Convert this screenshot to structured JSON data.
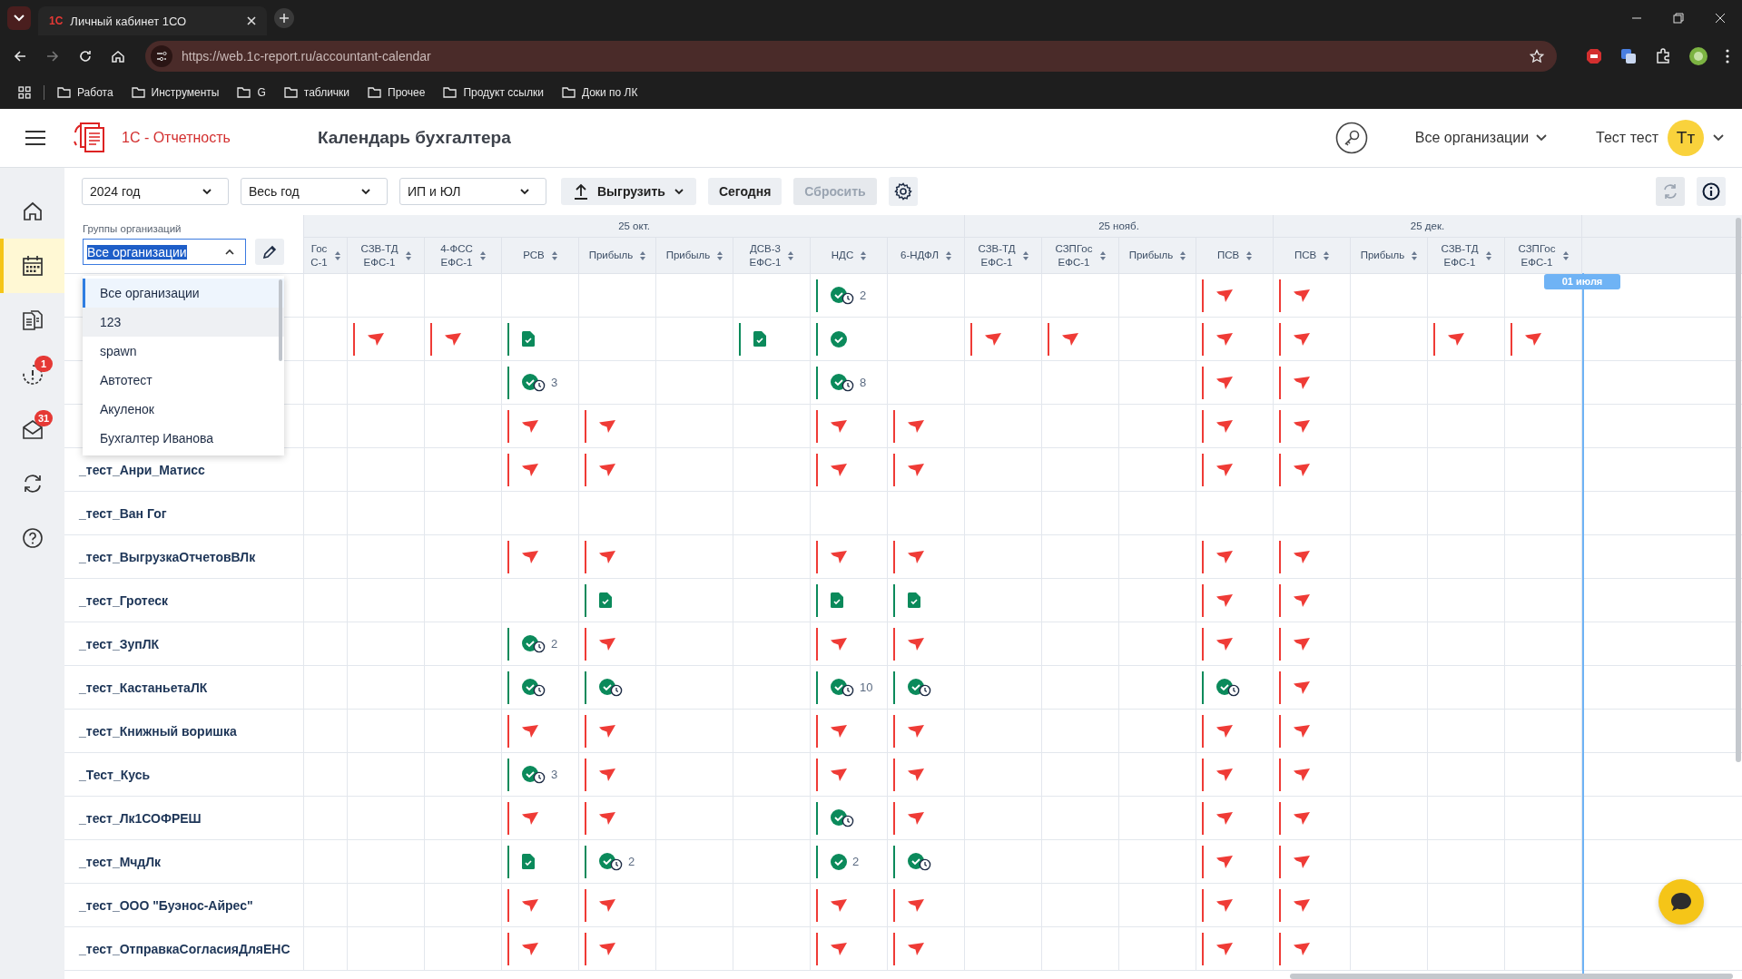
{
  "browser": {
    "tab": {
      "favicon": "1С",
      "title": "Личный кабинет 1СО"
    },
    "url": "https://web.1c-report.ru/accountant-calendar",
    "bookmarks": [
      "Работа",
      "Инструменты",
      "G",
      "таблички",
      "Прочее",
      "Продукт ссылки",
      "Доки по ЛК"
    ]
  },
  "header": {
    "brand": "1С - Отчетность",
    "title": "Календарь бухгалтера",
    "org_menu": "Все организации",
    "user": "Тест тест",
    "avatar": "Тт"
  },
  "sidebar": [
    {
      "kind": "home",
      "selected": false
    },
    {
      "kind": "calendar",
      "selected": true
    },
    {
      "kind": "documents",
      "selected": false
    },
    {
      "kind": "alerts",
      "selected": false,
      "badge": "1"
    },
    {
      "kind": "mail",
      "selected": false,
      "badge": "31"
    },
    {
      "kind": "sync",
      "selected": false
    },
    {
      "kind": "help",
      "selected": false
    }
  ],
  "toolbar": {
    "selects": [
      "2024 год",
      "Весь год",
      "ИП и ЮЛ"
    ],
    "export": "Выгрузить",
    "today": "Сегодня",
    "reset": {
      "label": "Сбросить",
      "disabled": true
    },
    "refresh_disabled": true
  },
  "filter": {
    "label": "Группы организаций",
    "value": "Все организации",
    "expanded": true,
    "options": [
      {
        "label": "Все организации",
        "selected": true,
        "hovered": false
      },
      {
        "label": "123",
        "selected": false,
        "hovered": true
      },
      {
        "label": "spawn",
        "selected": false,
        "hovered": false
      },
      {
        "label": "Автотест",
        "selected": false,
        "hovered": false
      },
      {
        "label": "Акуленок",
        "selected": false,
        "hovered": false
      },
      {
        "label": "Бухгалтер Иванова",
        "selected": false,
        "hovered": false
      }
    ]
  },
  "calendar": {
    "today_marker": "01 июля",
    "groups": [
      {
        "date": "25 окт.",
        "columns": [
          {
            "lines": [
              "Гос",
              "С-1"
            ],
            "partial": true
          },
          {
            "lines": [
              "СЗВ-ТД",
              "ЕФС-1"
            ]
          },
          {
            "lines": [
              "4-ФСС",
              "ЕФС-1"
            ]
          },
          {
            "lines": [
              "РСВ"
            ]
          },
          {
            "lines": [
              "Прибыль"
            ]
          },
          {
            "lines": [
              "Прибыль"
            ]
          },
          {
            "lines": [
              "ДСВ-3",
              "ЕФС-1"
            ]
          },
          {
            "lines": [
              "НДС"
            ]
          },
          {
            "lines": [
              "6-НДФЛ"
            ]
          }
        ]
      },
      {
        "date": "25 нояб.",
        "columns": [
          {
            "lines": [
              "СЗВ-ТД",
              "ЕФС-1"
            ]
          },
          {
            "lines": [
              "СЗПГос",
              "ЕФС-1"
            ]
          },
          {
            "lines": [
              "Прибыль"
            ]
          },
          {
            "lines": [
              "ПСВ"
            ]
          }
        ]
      },
      {
        "date": "25 дек.",
        "columns": [
          {
            "lines": [
              "ПСВ"
            ]
          },
          {
            "lines": [
              "Прибыль"
            ]
          },
          {
            "lines": [
              "СЗВ-ТД",
              "ЕФС-1"
            ]
          },
          {
            "lines": [
              "СЗПГос",
              "ЕФС-1"
            ]
          }
        ]
      }
    ],
    "rows": [
      {
        "cells": [
          {
            "kind": "none"
          },
          {
            "kind": "none"
          },
          {
            "kind": "none"
          },
          {
            "kind": "none"
          },
          {
            "kind": "none"
          },
          {
            "kind": "none"
          },
          {
            "kind": "none"
          },
          {
            "kind": "pending",
            "count": "2"
          },
          {
            "kind": "none"
          },
          {
            "kind": "none"
          },
          {
            "kind": "none"
          },
          {
            "kind": "none"
          },
          {
            "kind": "sent"
          },
          {
            "kind": "sent"
          },
          {
            "kind": "none"
          },
          {
            "kind": "none"
          },
          {
            "kind": "none"
          }
        ]
      },
      {
        "cells": [
          {
            "kind": "none"
          },
          {
            "kind": "sent"
          },
          {
            "kind": "sent"
          },
          {
            "kind": "doc"
          },
          {
            "kind": "none"
          },
          {
            "kind": "none"
          },
          {
            "kind": "doc"
          },
          {
            "kind": "accepted"
          },
          {
            "kind": "none"
          },
          {
            "kind": "sent"
          },
          {
            "kind": "sent"
          },
          {
            "kind": "none"
          },
          {
            "kind": "sent"
          },
          {
            "kind": "sent"
          },
          {
            "kind": "none"
          },
          {
            "kind": "sent"
          },
          {
            "kind": "sent"
          }
        ]
      },
      {
        "cells": [
          {
            "kind": "none"
          },
          {
            "kind": "none"
          },
          {
            "kind": "none"
          },
          {
            "kind": "pending",
            "count": "3"
          },
          {
            "kind": "none"
          },
          {
            "kind": "none"
          },
          {
            "kind": "none"
          },
          {
            "kind": "pending",
            "count": "8"
          },
          {
            "kind": "none"
          },
          {
            "kind": "none"
          },
          {
            "kind": "none"
          },
          {
            "kind": "none"
          },
          {
            "kind": "sent"
          },
          {
            "kind": "sent"
          },
          {
            "kind": "none"
          },
          {
            "kind": "none"
          },
          {
            "kind": "none"
          }
        ]
      },
      {
        "cells": [
          {
            "kind": "none"
          },
          {
            "kind": "none"
          },
          {
            "kind": "none"
          },
          {
            "kind": "sent"
          },
          {
            "kind": "sent"
          },
          {
            "kind": "none"
          },
          {
            "kind": "none"
          },
          {
            "kind": "sent"
          },
          {
            "kind": "sent"
          },
          {
            "kind": "none"
          },
          {
            "kind": "none"
          },
          {
            "kind": "none"
          },
          {
            "kind": "sent"
          },
          {
            "kind": "sent"
          },
          {
            "kind": "none"
          },
          {
            "kind": "none"
          },
          {
            "kind": "none"
          }
        ]
      },
      {
        "name": "_тест_Анри_Матисс",
        "cells": [
          {
            "kind": "none"
          },
          {
            "kind": "none"
          },
          {
            "kind": "none"
          },
          {
            "kind": "sent"
          },
          {
            "kind": "sent"
          },
          {
            "kind": "none"
          },
          {
            "kind": "none"
          },
          {
            "kind": "sent"
          },
          {
            "kind": "sent"
          },
          {
            "kind": "none"
          },
          {
            "kind": "none"
          },
          {
            "kind": "none"
          },
          {
            "kind": "sent"
          },
          {
            "kind": "sent"
          },
          {
            "kind": "none"
          },
          {
            "kind": "none"
          },
          {
            "kind": "none"
          }
        ]
      },
      {
        "name": "_тест_Ван Гог",
        "cells": [
          {
            "kind": "none"
          },
          {
            "kind": "none"
          },
          {
            "kind": "none"
          },
          {
            "kind": "none"
          },
          {
            "kind": "none"
          },
          {
            "kind": "none"
          },
          {
            "kind": "none"
          },
          {
            "kind": "none"
          },
          {
            "kind": "none"
          },
          {
            "kind": "none"
          },
          {
            "kind": "none"
          },
          {
            "kind": "none"
          },
          {
            "kind": "none"
          },
          {
            "kind": "none"
          },
          {
            "kind": "none"
          },
          {
            "kind": "none"
          },
          {
            "kind": "none"
          }
        ]
      },
      {
        "name": "_тест_ВыгрузкаОтчетовВЛк",
        "cells": [
          {
            "kind": "none"
          },
          {
            "kind": "none"
          },
          {
            "kind": "none"
          },
          {
            "kind": "sent"
          },
          {
            "kind": "sent"
          },
          {
            "kind": "none"
          },
          {
            "kind": "none"
          },
          {
            "kind": "sent"
          },
          {
            "kind": "sent"
          },
          {
            "kind": "none"
          },
          {
            "kind": "none"
          },
          {
            "kind": "none"
          },
          {
            "kind": "sent"
          },
          {
            "kind": "sent"
          },
          {
            "kind": "none"
          },
          {
            "kind": "none"
          },
          {
            "kind": "none"
          }
        ]
      },
      {
        "name": "_тест_Гротеск",
        "cells": [
          {
            "kind": "none"
          },
          {
            "kind": "none"
          },
          {
            "kind": "none"
          },
          {
            "kind": "none"
          },
          {
            "kind": "doc"
          },
          {
            "kind": "none"
          },
          {
            "kind": "none"
          },
          {
            "kind": "doc"
          },
          {
            "kind": "doc"
          },
          {
            "kind": "none"
          },
          {
            "kind": "none"
          },
          {
            "kind": "none"
          },
          {
            "kind": "sent"
          },
          {
            "kind": "sent"
          },
          {
            "kind": "none"
          },
          {
            "kind": "none"
          },
          {
            "kind": "none"
          }
        ]
      },
      {
        "name": "_тест_ЗупЛК",
        "cells": [
          {
            "kind": "none"
          },
          {
            "kind": "none"
          },
          {
            "kind": "none"
          },
          {
            "kind": "pending",
            "count": "2"
          },
          {
            "kind": "sent"
          },
          {
            "kind": "none"
          },
          {
            "kind": "none"
          },
          {
            "kind": "sent"
          },
          {
            "kind": "sent"
          },
          {
            "kind": "none"
          },
          {
            "kind": "none"
          },
          {
            "kind": "none"
          },
          {
            "kind": "sent"
          },
          {
            "kind": "sent"
          },
          {
            "kind": "none"
          },
          {
            "kind": "none"
          },
          {
            "kind": "none"
          }
        ]
      },
      {
        "name": "_тест_КастаньетаЛК",
        "cells": [
          {
            "kind": "none"
          },
          {
            "kind": "none"
          },
          {
            "kind": "none"
          },
          {
            "kind": "pending"
          },
          {
            "kind": "pending"
          },
          {
            "kind": "none"
          },
          {
            "kind": "none"
          },
          {
            "kind": "pending",
            "count": "10"
          },
          {
            "kind": "pending"
          },
          {
            "kind": "none"
          },
          {
            "kind": "none"
          },
          {
            "kind": "none"
          },
          {
            "kind": "pending"
          },
          {
            "kind": "sent"
          },
          {
            "kind": "none"
          },
          {
            "kind": "none"
          },
          {
            "kind": "none"
          }
        ]
      },
      {
        "name": "_тест_Книжный воришка",
        "cells": [
          {
            "kind": "none"
          },
          {
            "kind": "none"
          },
          {
            "kind": "none"
          },
          {
            "kind": "sent"
          },
          {
            "kind": "sent"
          },
          {
            "kind": "none"
          },
          {
            "kind": "none"
          },
          {
            "kind": "sent"
          },
          {
            "kind": "sent"
          },
          {
            "kind": "none"
          },
          {
            "kind": "none"
          },
          {
            "kind": "none"
          },
          {
            "kind": "sent"
          },
          {
            "kind": "sent"
          },
          {
            "kind": "none"
          },
          {
            "kind": "none"
          },
          {
            "kind": "none"
          }
        ]
      },
      {
        "name": "_Тест_Кусь",
        "cells": [
          {
            "kind": "none"
          },
          {
            "kind": "none"
          },
          {
            "kind": "none"
          },
          {
            "kind": "pending",
            "count": "3"
          },
          {
            "kind": "sent"
          },
          {
            "kind": "none"
          },
          {
            "kind": "none"
          },
          {
            "kind": "sent"
          },
          {
            "kind": "sent"
          },
          {
            "kind": "none"
          },
          {
            "kind": "none"
          },
          {
            "kind": "none"
          },
          {
            "kind": "sent"
          },
          {
            "kind": "sent"
          },
          {
            "kind": "none"
          },
          {
            "kind": "none"
          },
          {
            "kind": "none"
          }
        ]
      },
      {
        "name": "_тест_Лк1СОФРЕШ",
        "cells": [
          {
            "kind": "none"
          },
          {
            "kind": "none"
          },
          {
            "kind": "none"
          },
          {
            "kind": "sent"
          },
          {
            "kind": "sent"
          },
          {
            "kind": "none"
          },
          {
            "kind": "none"
          },
          {
            "kind": "pending"
          },
          {
            "kind": "sent"
          },
          {
            "kind": "none"
          },
          {
            "kind": "none"
          },
          {
            "kind": "none"
          },
          {
            "kind": "sent"
          },
          {
            "kind": "sent"
          },
          {
            "kind": "none"
          },
          {
            "kind": "none"
          },
          {
            "kind": "none"
          }
        ]
      },
      {
        "name": "_тест_МчдЛк",
        "cells": [
          {
            "kind": "none"
          },
          {
            "kind": "none"
          },
          {
            "kind": "none"
          },
          {
            "kind": "doc"
          },
          {
            "kind": "pending",
            "count": "2"
          },
          {
            "kind": "none"
          },
          {
            "kind": "none"
          },
          {
            "kind": "accepted",
            "count": "2"
          },
          {
            "kind": "pending"
          },
          {
            "kind": "none"
          },
          {
            "kind": "none"
          },
          {
            "kind": "none"
          },
          {
            "kind": "sent"
          },
          {
            "kind": "sent"
          },
          {
            "kind": "none"
          },
          {
            "kind": "none"
          },
          {
            "kind": "none"
          }
        ]
      },
      {
        "name": "_тест_ООО \"Буэнос-Айрес\"",
        "cells": [
          {
            "kind": "none"
          },
          {
            "kind": "none"
          },
          {
            "kind": "none"
          },
          {
            "kind": "sent"
          },
          {
            "kind": "sent"
          },
          {
            "kind": "none"
          },
          {
            "kind": "none"
          },
          {
            "kind": "sent"
          },
          {
            "kind": "sent"
          },
          {
            "kind": "none"
          },
          {
            "kind": "none"
          },
          {
            "kind": "none"
          },
          {
            "kind": "sent"
          },
          {
            "kind": "sent"
          },
          {
            "kind": "none"
          },
          {
            "kind": "none"
          },
          {
            "kind": "none"
          }
        ]
      },
      {
        "name": "_тест_ОтправкаСогласияДляЕНС",
        "cells": [
          {
            "kind": "none"
          },
          {
            "kind": "none"
          },
          {
            "kind": "none"
          },
          {
            "kind": "sent"
          },
          {
            "kind": "sent"
          },
          {
            "kind": "none"
          },
          {
            "kind": "none"
          },
          {
            "kind": "sent"
          },
          {
            "kind": "sent"
          },
          {
            "kind": "none"
          },
          {
            "kind": "none"
          },
          {
            "kind": "none"
          },
          {
            "kind": "sent"
          },
          {
            "kind": "sent"
          },
          {
            "kind": "none"
          },
          {
            "kind": "none"
          },
          {
            "kind": "none"
          }
        ]
      }
    ]
  }
}
